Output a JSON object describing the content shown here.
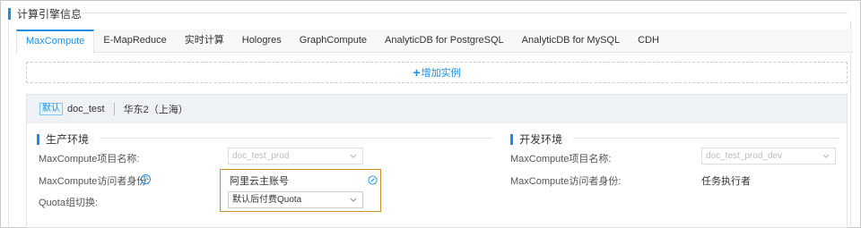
{
  "section": {
    "title": "计算引擎信息"
  },
  "tabs": [
    "MaxCompute",
    "E-MapReduce",
    "实时计算",
    "Hologres",
    "GraphCompute",
    "AnalyticDB for PostgreSQL",
    "AnalyticDB for MySQL",
    "CDH"
  ],
  "active_tab": "MaxCompute",
  "add_instance": {
    "label": "增加实例"
  },
  "instance": {
    "badge": "默认",
    "name": "doc_test",
    "region": "华东2（上海）",
    "prod": {
      "title": "生产环境",
      "project_label": "MaxCompute项目名称:",
      "project_value": "doc_test_prod",
      "identity_label": "MaxCompute访问者身份:",
      "identity_value": "阿里云主账号",
      "quota_label": "Quota组切换:",
      "quota_value": "默认后付费Quota"
    },
    "dev": {
      "title": "开发环境",
      "project_label": "MaxCompute项目名称:",
      "project_value": "doc_test_prod_dev",
      "identity_label": "MaxCompute访问者身份:",
      "identity_value": "任务执行者"
    }
  },
  "colors": {
    "accent": "#1c8ee6",
    "highlight_border": "#d38b26"
  },
  "icons": {
    "help": "question-circle-icon",
    "edit": "edit-icon",
    "dropdown": "chevron-down-icon",
    "add": "plus-icon"
  }
}
